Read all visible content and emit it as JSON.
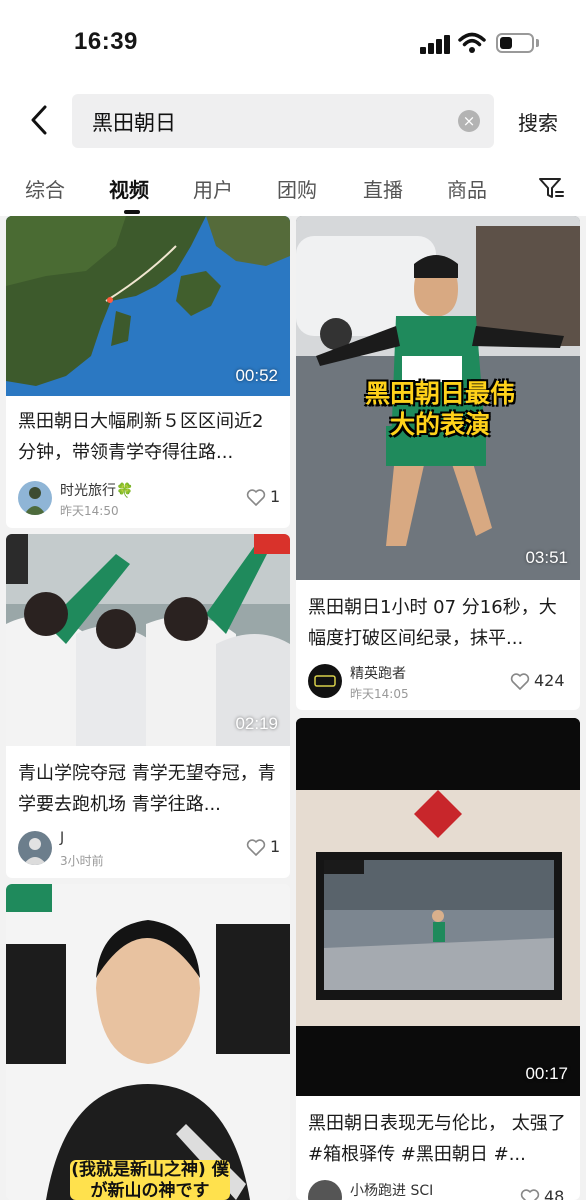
{
  "status": {
    "time": "16:39"
  },
  "search": {
    "query": "黑田朝日",
    "clear": "×",
    "button": "搜索"
  },
  "tabs": [
    "综合",
    "视频",
    "用户",
    "团购",
    "直播",
    "商品"
  ],
  "active_tab": "视频",
  "cards": [
    {
      "duration": "00:52",
      "title": "黑田朝日大幅刷新５区区间近2分钟，带领青学夺得往路...",
      "author": "时光旅行🍀",
      "time": "昨天14:50",
      "likes": "1"
    },
    {
      "duration": "03:51",
      "overlay_caption": "黑田朝日最伟大的表演",
      "title": "黑田朝日1小时 07 分16秒，大幅度打破区间纪录，抹平...",
      "author": "精英跑者",
      "time": "昨天14:05",
      "likes": "424"
    },
    {
      "duration": "02:19",
      "title": "青山学院夺冠 青学无望夺冠，青学要去跑机场 青学往路...",
      "author": "J",
      "time": "3小时前",
      "likes": "1"
    },
    {
      "duration": "00:17",
      "title": "黑田朝日表现无与伦比， 太强了#箱根驿传 #黑田朝日 #...",
      "author": "小杨跑进 SCI",
      "likes": "48"
    },
    {
      "subtitle": "(我就是新山之神)\n僕が新山の神です"
    }
  ],
  "colors": {
    "accent": "#111111",
    "background": "#f2f2f2",
    "caption_yellow": "#ffd21a"
  }
}
